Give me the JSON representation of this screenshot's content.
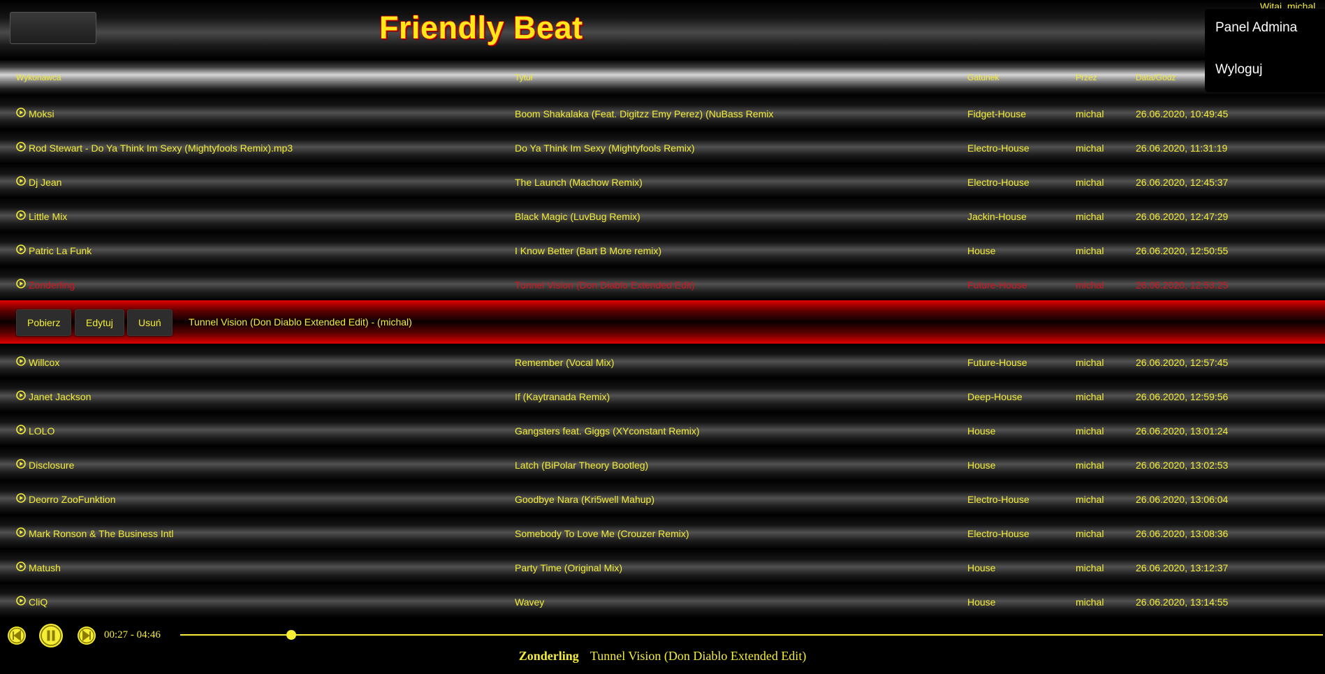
{
  "header": {
    "title": "Friendly Beat",
    "welcome": "Witaj, michal"
  },
  "user_menu": {
    "admin_panel": "Panel Admina",
    "logout": "Wyloguj"
  },
  "columns": {
    "artist": "Wykonawca",
    "title": "Tytuł",
    "genre": "Gatunek",
    "by": "Przez",
    "date": "Data/Godz"
  },
  "tracks": [
    {
      "artist": "Moksi",
      "title": "Boom Shakalaka (Feat. Digitzz Emy Perez) (NuBass Remix",
      "genre": "Fidget-House",
      "by": "michal",
      "date": "26.06.2020, 10:49:45"
    },
    {
      "artist": "Rod Stewart - Do Ya Think Im Sexy (Mightyfools Remix).mp3",
      "title": "Do Ya Think Im Sexy (Mightyfools Remix)",
      "genre": "Electro-House",
      "by": "michal",
      "date": "26.06.2020, 11:31:19"
    },
    {
      "artist": "Dj Jean",
      "title": "The Launch (Machow Remix)",
      "genre": "Electro-House",
      "by": "michal",
      "date": "26.06.2020, 12:45:37"
    },
    {
      "artist": "Little Mix",
      "title": "Black Magic (LuvBug Remix)",
      "genre": "Jackin-House",
      "by": "michal",
      "date": "26.06.2020, 12:47:29"
    },
    {
      "artist": "Patric La Funk",
      "title": "I Know Better (Bart B More remix)",
      "genre": "House",
      "by": "michal",
      "date": "26.06.2020, 12:50:55"
    },
    {
      "artist": "Zonderling",
      "title": "Tunnel Vision (Don Diablo Extended Edit)",
      "genre": "Future-House",
      "by": "michal",
      "date": "26.06.2020, 12:53:25"
    },
    {
      "artist": "Willcox",
      "title": "Remember (Vocal Mix)",
      "genre": "Future-House",
      "by": "michal",
      "date": "26.06.2020, 12:57:45"
    },
    {
      "artist": "Janet Jackson",
      "title": "If (Kaytranada Remix)",
      "genre": "Deep-House",
      "by": "michal",
      "date": "26.06.2020, 12:59:56"
    },
    {
      "artist": "LOLO",
      "title": "Gangsters feat. Giggs (XYconstant Remix)",
      "genre": "House",
      "by": "michal",
      "date": "26.06.2020, 13:01:24"
    },
    {
      "artist": "Disclosure",
      "title": "Latch (BiPolar Theory Bootleg)",
      "genre": "House",
      "by": "michal",
      "date": "26.06.2020, 13:02:53"
    },
    {
      "artist": "Deorro ZooFunktion",
      "title": "Goodbye Nara (Kri5well Mahup)",
      "genre": "Electro-House",
      "by": "michal",
      "date": "26.06.2020, 13:06:04"
    },
    {
      "artist": "Mark Ronson & The Business Intl",
      "title": "Somebody To Love Me (Crouzer Remix)",
      "genre": "Electro-House",
      "by": "michal",
      "date": "26.06.2020, 13:08:36"
    },
    {
      "artist": "Matush",
      "title": "Party Time (Original Mix)",
      "genre": "House",
      "by": "michal",
      "date": "26.06.2020, 13:12:37"
    },
    {
      "artist": "CliQ",
      "title": "Wavey",
      "genre": "House",
      "by": "michal",
      "date": "26.06.2020, 13:14:55"
    }
  ],
  "selected_track_index": 5,
  "action_bar": {
    "download": "Pobierz",
    "edit": "Edytuj",
    "delete": "Usuń",
    "info": "Tunnel Vision (Don Diablo Extended Edit) - (michal)"
  },
  "player": {
    "time": "00:27 - 04:46",
    "progress": 0.0972,
    "now_artist": "Zonderling",
    "now_title": "Tunnel Vision (Don Diablo Extended Edit)",
    "icons": [
      "previous-icon",
      "pause-icon",
      "next-icon"
    ]
  },
  "colors": {
    "text": "#f5ee35",
    "active_text": "#d4141e",
    "accent_red": "#e00000"
  }
}
